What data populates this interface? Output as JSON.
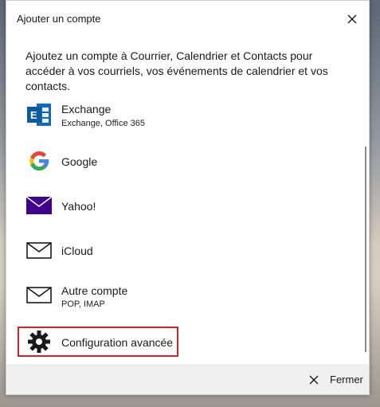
{
  "dialog": {
    "title": "Ajouter un compte",
    "intro": "Ajoutez un compte à Courrier, Calendrier et Contacts pour accéder à vos courriels, vos événements de calendrier et vos contacts.",
    "accounts": [
      {
        "name": "Exchange",
        "sub": "Exchange, Office 365",
        "icon": "exchange-icon"
      },
      {
        "name": "Google",
        "sub": "",
        "icon": "google-icon"
      },
      {
        "name": "Yahoo!",
        "sub": "",
        "icon": "yahoo-mail-icon"
      },
      {
        "name": "iCloud",
        "sub": "",
        "icon": "mail-envelope-icon"
      },
      {
        "name": "Autre compte",
        "sub": "POP, IMAP",
        "icon": "mail-envelope-icon"
      },
      {
        "name": "Configuration avancée",
        "sub": "",
        "icon": "gear-icon"
      }
    ],
    "footer": {
      "close_label": "Fermer"
    }
  },
  "colors": {
    "exchange_blue": "#0f6cbd",
    "yahoo_purple": "#400090",
    "highlight_red": "#d2232a",
    "footer_bg": "#f0f0f0"
  }
}
